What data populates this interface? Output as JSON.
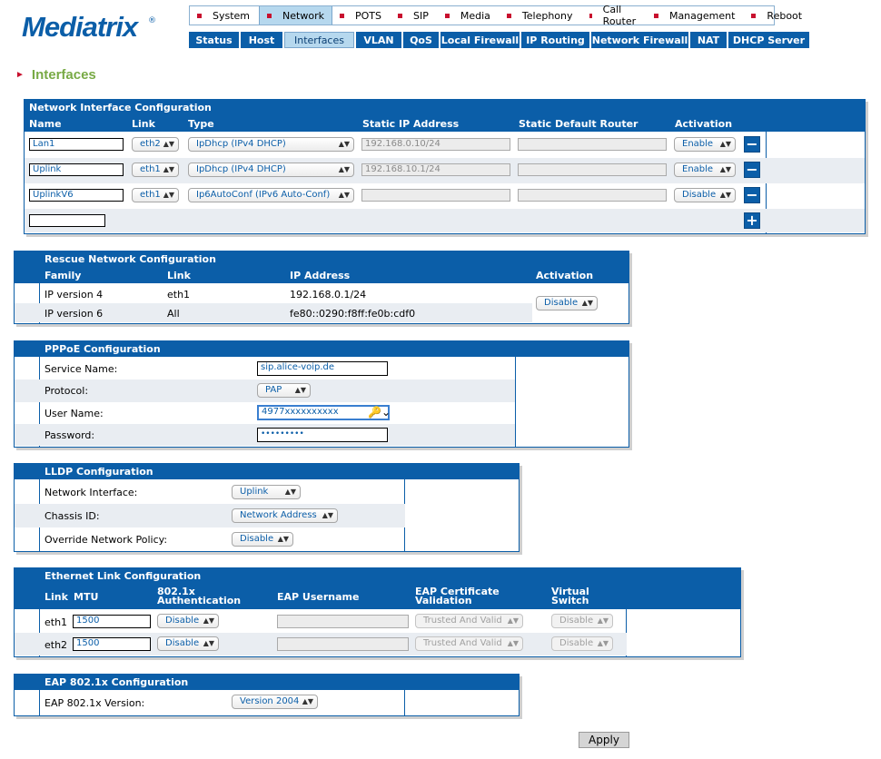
{
  "brand": {
    "name": "Mediatrix",
    "reg": "®"
  },
  "main_nav": [
    {
      "label": "System",
      "active": false
    },
    {
      "label": "Network",
      "active": true
    },
    {
      "label": "POTS",
      "active": false
    },
    {
      "label": "SIP",
      "active": false
    },
    {
      "label": "Media",
      "active": false
    },
    {
      "label": "Telephony",
      "active": false
    },
    {
      "label": "Call Router",
      "active": false
    },
    {
      "label": "Management",
      "active": false
    },
    {
      "label": "Reboot",
      "active": false
    }
  ],
  "sub_nav": [
    {
      "label": "Status",
      "active": false
    },
    {
      "label": "Host",
      "active": false
    },
    {
      "label": "Interfaces",
      "active": true
    },
    {
      "label": "VLAN",
      "active": false
    },
    {
      "label": "QoS",
      "active": false
    },
    {
      "label": "Local Firewall",
      "active": false
    },
    {
      "label": "IP Routing",
      "active": false
    },
    {
      "label": "Network Firewall",
      "active": false
    },
    {
      "label": "NAT",
      "active": false
    },
    {
      "label": "DHCP Server",
      "active": false
    }
  ],
  "page_title": "Interfaces",
  "network_interface": {
    "title": "Network Interface Configuration",
    "columns": {
      "name": "Name",
      "link": "Link",
      "type": "Type",
      "static_ip": "Static IP Address",
      "static_router": "Static Default Router",
      "activation": "Activation"
    },
    "rows": [
      {
        "name": "Lan1",
        "link": "eth2",
        "type": "IpDhcp (IPv4 DHCP)",
        "static_ip": "192.168.0.10/24",
        "static_router": "",
        "activation": "Enable"
      },
      {
        "name": "Uplink",
        "link": "eth1",
        "type": "IpDhcp (IPv4 DHCP)",
        "static_ip": "192.168.10.1/24",
        "static_router": "",
        "activation": "Enable"
      },
      {
        "name": "UplinkV6",
        "link": "eth1",
        "type": "Ip6AutoConf (IPv6 Auto-Conf)",
        "static_ip": "",
        "static_router": "",
        "activation": "Disable"
      }
    ],
    "new_name": "",
    "remove_glyph": "−",
    "add_glyph": "+"
  },
  "rescue": {
    "title": "Rescue Network Configuration",
    "columns": {
      "family": "Family",
      "link": "Link",
      "ip": "IP Address",
      "activation": "Activation"
    },
    "rows": [
      {
        "family": "IP version 4",
        "link": "eth1",
        "ip": "192.168.0.1/24"
      },
      {
        "family": "IP version 6",
        "link": "All",
        "ip": "fe80::0290:f8ff:fe0b:cdf0"
      }
    ],
    "activation": "Disable"
  },
  "pppoe": {
    "title": "PPPoE Configuration",
    "service_label": "Service Name:",
    "service_value": "sip.alice-voip.de",
    "protocol_label": "Protocol:",
    "protocol_value": "PAP",
    "user_label": "User Name:",
    "user_value": "4977xxxxxxxxxx",
    "password_label": "Password:",
    "password_value": "•••••••••"
  },
  "lldp": {
    "title": "LLDP Configuration",
    "iface_label": "Network Interface:",
    "iface_value": "Uplink",
    "chassis_label": "Chassis ID:",
    "chassis_value": "Network Address",
    "override_label": "Override Network Policy:",
    "override_value": "Disable"
  },
  "ethernet": {
    "title": "Ethernet Link Configuration",
    "columns": {
      "link": "Link",
      "mtu": "MTU",
      "auth_1": "802.1x",
      "auth_2": "Authentication",
      "eap_user": "EAP Username",
      "eap_cert_1": "EAP Certificate",
      "eap_cert_2": "Validation",
      "vswitch_1": "Virtual",
      "vswitch_2": "Switch"
    },
    "rows": [
      {
        "link": "eth1",
        "mtu": "1500",
        "auth": "Disable",
        "eap_user": "",
        "eap_cert": "Trusted And Valid",
        "vswitch": "Disable"
      },
      {
        "link": "eth2",
        "mtu": "1500",
        "auth": "Disable",
        "eap_user": "",
        "eap_cert": "Trusted And Valid",
        "vswitch": "Disable"
      }
    ]
  },
  "eap": {
    "title": "EAP 802.1x Configuration",
    "version_label": "EAP 802.1x Version:",
    "version_value": "Version 2004"
  },
  "apply_label": "Apply"
}
